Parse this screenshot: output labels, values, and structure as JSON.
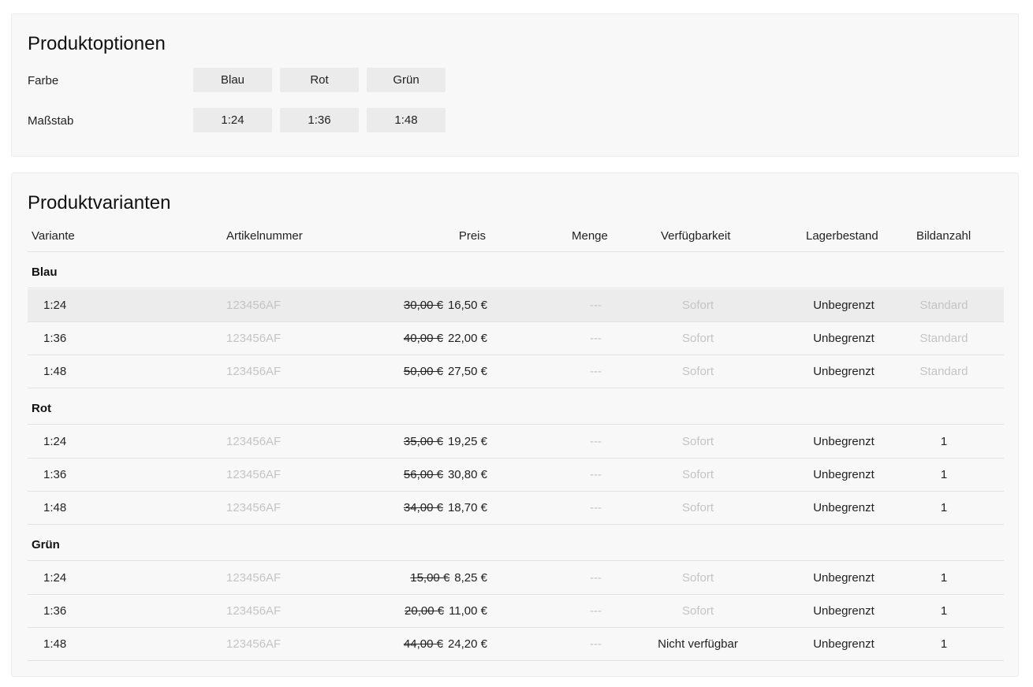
{
  "options": {
    "title": "Produktoptionen",
    "farbe_label": "Farbe",
    "farbe_values": [
      "Blau",
      "Rot",
      "Grün"
    ],
    "massstab_label": "Maßstab",
    "massstab_values": [
      "1:24",
      "1:36",
      "1:48"
    ]
  },
  "variants": {
    "title": "Produktvarianten",
    "columns": {
      "variante": "Variante",
      "artikelnummer": "Artikelnummer",
      "preis": "Preis",
      "menge": "Menge",
      "verfuegbarkeit": "Verfügbarkeit",
      "lagerbestand": "Lagerbestand",
      "bildanzahl": "Bildanzahl"
    },
    "groups": [
      {
        "name": "Blau",
        "rows": [
          {
            "variant": "1:24",
            "sku": "123456AF",
            "old_price": "30,00 €",
            "price": "16,50 €",
            "menge": "---",
            "availability": "Sofort",
            "stock": "Unbegrenzt",
            "images": "Standard"
          },
          {
            "variant": "1:36",
            "sku": "123456AF",
            "old_price": "40,00 €",
            "price": "22,00 €",
            "menge": "---",
            "availability": "Sofort",
            "stock": "Unbegrenzt",
            "images": "Standard"
          },
          {
            "variant": "1:48",
            "sku": "123456AF",
            "old_price": "50,00 €",
            "price": "27,50 €",
            "menge": "---",
            "availability": "Sofort",
            "stock": "Unbegrenzt",
            "images": "Standard"
          }
        ]
      },
      {
        "name": "Rot",
        "rows": [
          {
            "variant": "1:24",
            "sku": "123456AF",
            "old_price": "35,00 €",
            "price": "19,25 €",
            "menge": "---",
            "availability": "Sofort",
            "stock": "Unbegrenzt",
            "images": "1"
          },
          {
            "variant": "1:36",
            "sku": "123456AF",
            "old_price": "56,00 €",
            "price": "30,80 €",
            "menge": "---",
            "availability": "Sofort",
            "stock": "Unbegrenzt",
            "images": "1"
          },
          {
            "variant": "1:48",
            "sku": "123456AF",
            "old_price": "34,00 €",
            "price": "18,70 €",
            "menge": "---",
            "availability": "Sofort",
            "stock": "Unbegrenzt",
            "images": "1"
          }
        ]
      },
      {
        "name": "Grün",
        "rows": [
          {
            "variant": "1:24",
            "sku": "123456AF",
            "old_price": "15,00 €",
            "price": "8,25 €",
            "menge": "---",
            "availability": "Sofort",
            "stock": "Unbegrenzt",
            "images": "1"
          },
          {
            "variant": "1:36",
            "sku": "123456AF",
            "old_price": "20,00 €",
            "price": "11,00 €",
            "menge": "---",
            "availability": "Sofort",
            "stock": "Unbegrenzt",
            "images": "1"
          },
          {
            "variant": "1:48",
            "sku": "123456AF",
            "old_price": "44,00 €",
            "price": "24,20 €",
            "menge": "---",
            "availability": "Nicht verfügbar",
            "stock": "Unbegrenzt",
            "images": "1"
          }
        ]
      }
    ]
  },
  "colors": {
    "card_bg": "#f8f8f8",
    "button_bg": "#ebebeb",
    "highlight_row": "#ececec",
    "muted_text": "#c4c4c4"
  }
}
